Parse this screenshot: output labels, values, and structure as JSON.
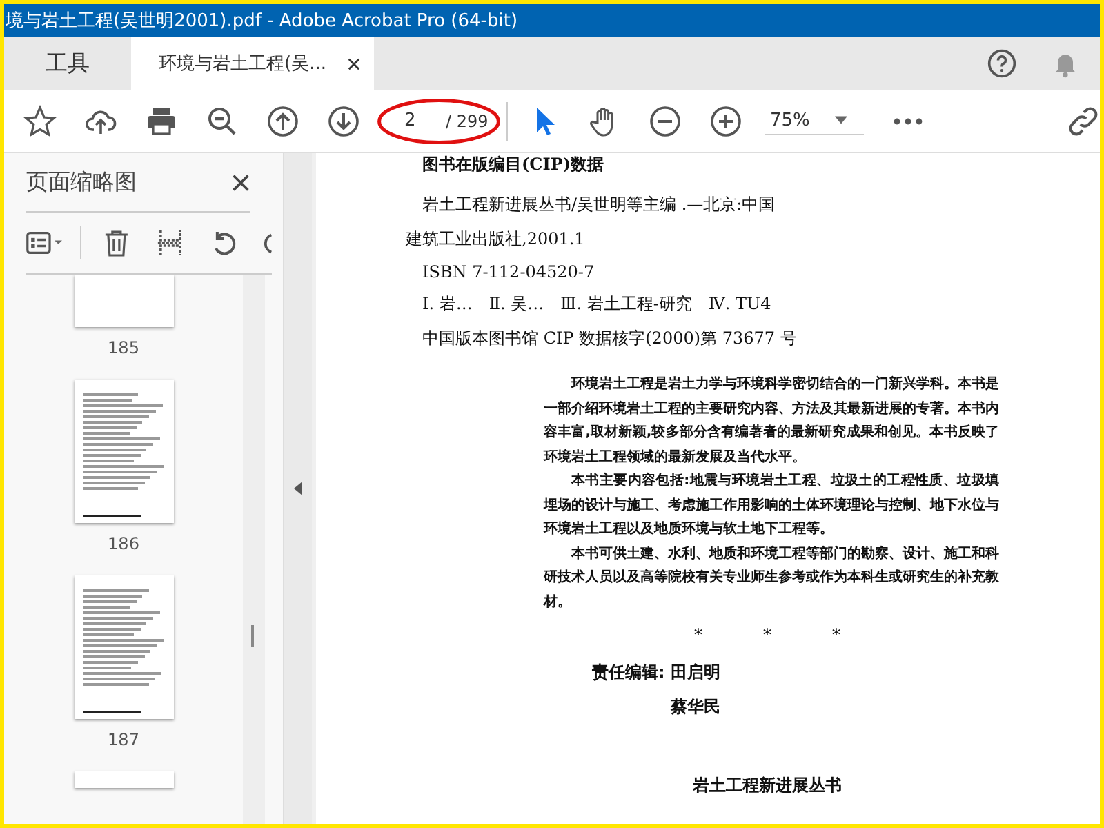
{
  "window": {
    "title": "境与岩土工程(吴世明2001).pdf - Adobe Acrobat Pro (64-bit)"
  },
  "tabs": [
    {
      "label": "工具",
      "selected": false
    },
    {
      "label": "环境与岩土工程(吴...",
      "selected": true
    }
  ],
  "toolbar": {
    "page_value": "2",
    "page_total": "/ 299",
    "zoom": "75%"
  },
  "sidebar": {
    "title": "页面缩略图",
    "thumbnails": [
      {
        "label": "185"
      },
      {
        "label": "186"
      },
      {
        "label": "187"
      }
    ]
  },
  "document": {
    "heading": "图书在版编目(CIP)数据",
    "cip_lines": [
      "岩土工程新进展丛书/吴世明等主编 .—北京:中国",
      "建筑工业出版社,2001.1",
      "ISBN 7-112-04520-7",
      "Ⅰ. 岩…　Ⅱ. 吴…　Ⅲ. 岩土工程-研究　Ⅳ. TU4",
      "中国版本图书馆 CIP 数据核字(2000)第 73677 号"
    ],
    "paragraphs": [
      "环境岩土工程是岩土力学与环境科学密切结合的一门新兴学科。本书是一部介绍环境岩土工程的主要研究内容、方法及其最新进展的专著。本书内容丰富,取材新颖,较多部分含有编著者的最新研究成果和创见。本书反映了环境岩土工程领域的最新发展及当代水平。",
      "本书主要内容包括:地震与环境岩土工程、垃圾土的工程性质、垃圾填埋场的设计与施工、考虑施工作用影响的土体环境理论与控制、地下水位与环境岩土工程以及地质环境与软土地下工程等。",
      "本书可供土建、水利、地质和环境工程等部门的勘察、设计、施工和科研技术人员以及高等院校有关专业师生参考或作为本科生或研究生的补充教材。"
    ],
    "stars": [
      "*",
      "*",
      "*"
    ],
    "editor_label": "责任编辑:",
    "editors": [
      "田启明",
      "蔡华民"
    ],
    "series_title": "岩土工程新进展丛书"
  }
}
